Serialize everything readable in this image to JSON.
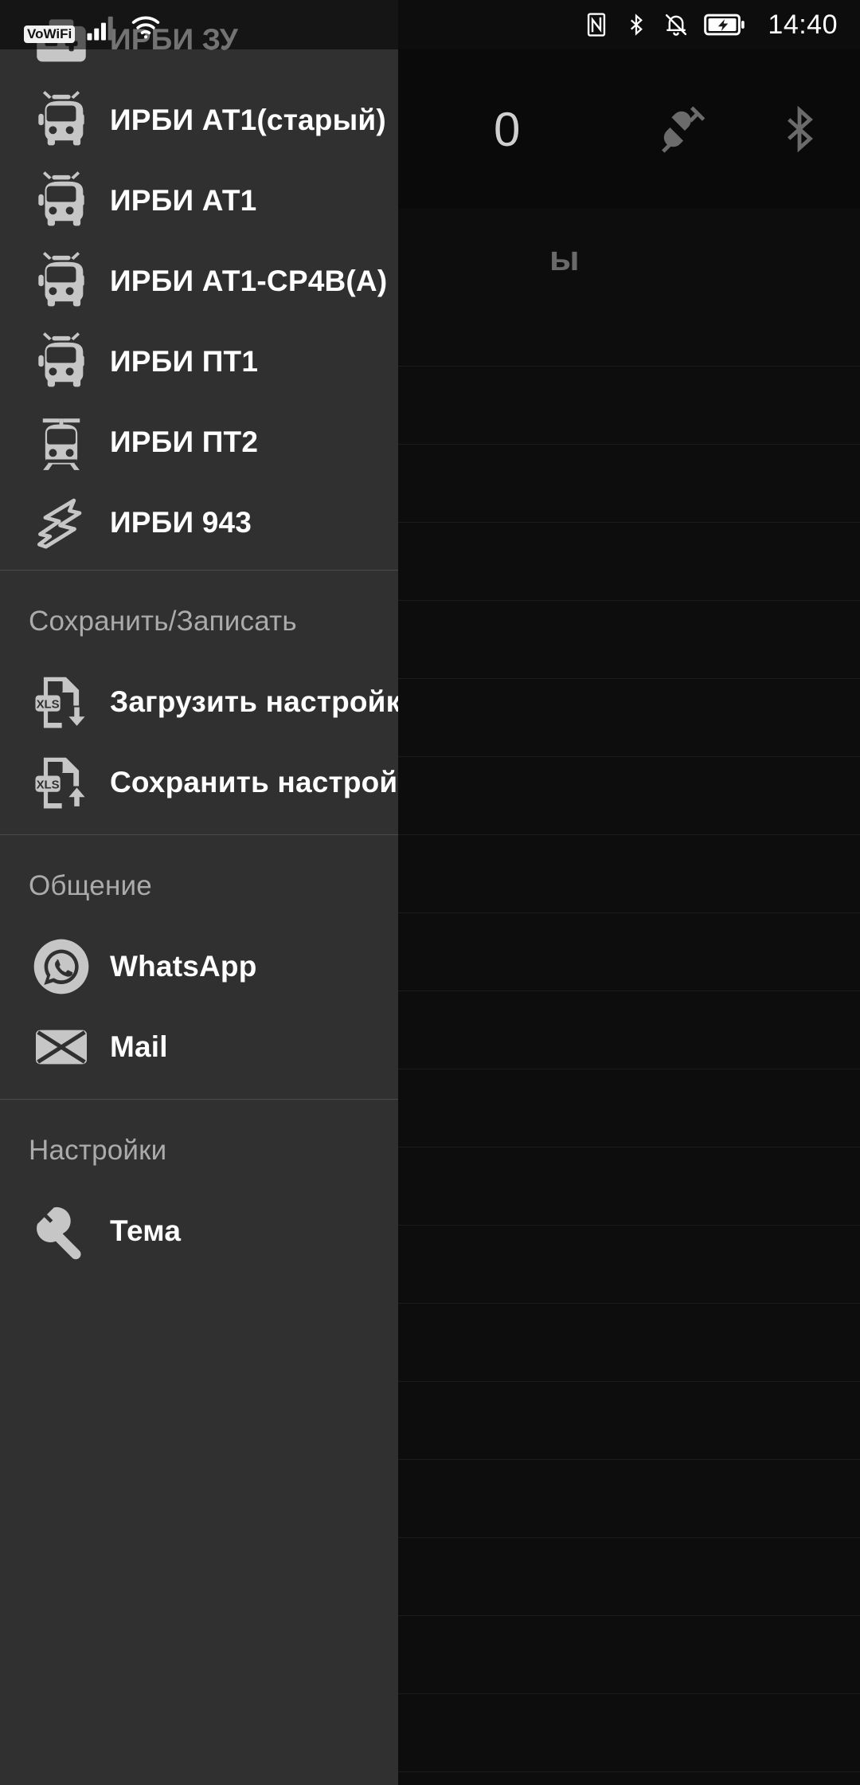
{
  "statusbar": {
    "left_icons": [
      "vowifi-icon",
      "signal-icon",
      "wifi-icon"
    ],
    "vowifi_label": "VoWiFi",
    "right_icons": [
      "nfc-icon",
      "bluetooth-icon",
      "mute-icon",
      "battery-charging-icon"
    ],
    "time": "14:40"
  },
  "background": {
    "appbar": {
      "count": "0",
      "icons": [
        "plug-disconnected-icon",
        "bluetooth-icon"
      ]
    },
    "section_title": "ы",
    "rows": 19
  },
  "drawer": {
    "top_item": {
      "label": "ИРБИ ЗУ",
      "icon": "battery-charger-icon"
    },
    "devices": [
      {
        "label": "ИРБИ АТ1(старый)",
        "icon": "trolleybus-icon"
      },
      {
        "label": "ИРБИ АТ1",
        "icon": "trolleybus-icon"
      },
      {
        "label": "ИРБИ АТ1-СР4В(А)",
        "icon": "trolleybus-icon"
      },
      {
        "label": "ИРБИ ПТ1",
        "icon": "trolleybus-icon"
      },
      {
        "label": "ИРБИ ПТ2",
        "icon": "tram-icon"
      },
      {
        "label": "ИРБИ 943",
        "icon": "lightning-bolt-icon"
      }
    ],
    "groups": [
      {
        "title": "Сохранить/Записать",
        "items": [
          {
            "label": "Загрузить настройки",
            "icon": "xls-download-icon"
          },
          {
            "label": "Сохранить настройки",
            "icon": "xls-upload-icon"
          }
        ]
      },
      {
        "title": "Общение",
        "items": [
          {
            "label": "WhatsApp",
            "icon": "whatsapp-icon"
          },
          {
            "label": "Mail",
            "icon": "mail-icon"
          }
        ]
      },
      {
        "title": "Настройки",
        "items": [
          {
            "label": "Тема",
            "icon": "wrench-icon"
          }
        ]
      }
    ]
  },
  "colors": {
    "drawer_bg": "#303030",
    "app_bg": "#0d0d0d",
    "icon_tint": "#c6c6c6",
    "label": "#ffffff",
    "group_title": "#ababab",
    "divider": "#4a4a4a"
  }
}
